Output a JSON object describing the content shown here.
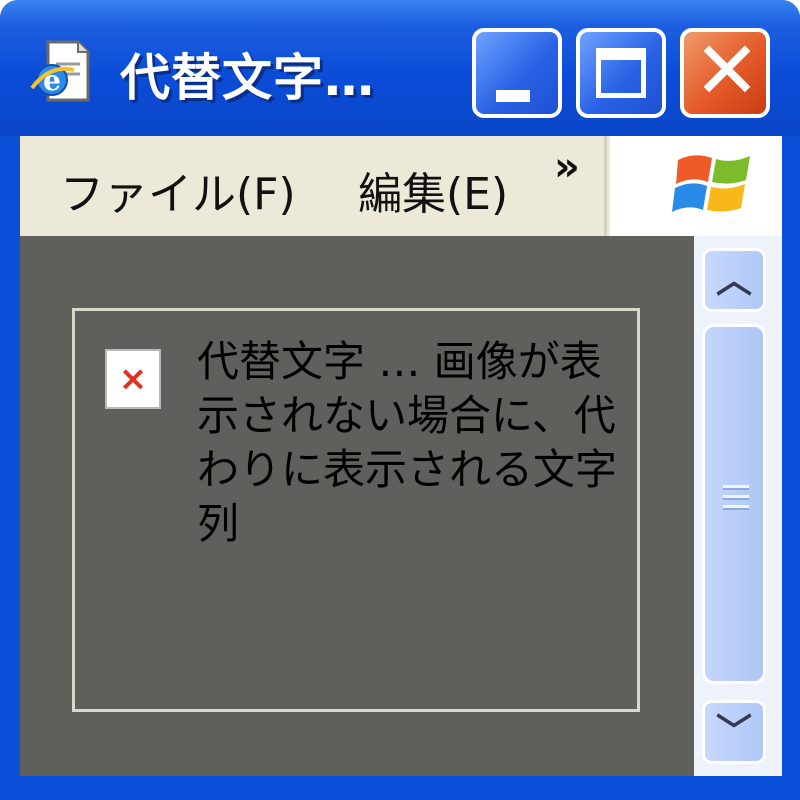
{
  "window": {
    "title": "代替文字…",
    "icon": "ie-document-icon",
    "buttons": {
      "minimize_icon": "minimize-icon",
      "maximize_icon": "maximize-icon",
      "close_glyph": "✕"
    }
  },
  "menu": {
    "items": [
      {
        "label": "ファイル(F)"
      },
      {
        "label": "編集(E)"
      }
    ],
    "overflow_label": "»",
    "logo": "windows-logo-icon"
  },
  "content": {
    "broken_image_glyph": "×",
    "alt_text": "代替文字 … 画像が表示されない場合に、代わりに表示される文字列"
  },
  "scrollbar": {
    "up_glyph": "︿",
    "down_glyph": "﹀"
  },
  "colors": {
    "titlebar": "#0a4fd8",
    "close_button": "#e45a28",
    "menubar": "#ece9d8",
    "content_bg": "#5f605c",
    "scrollbar": "#b0c8f8"
  }
}
